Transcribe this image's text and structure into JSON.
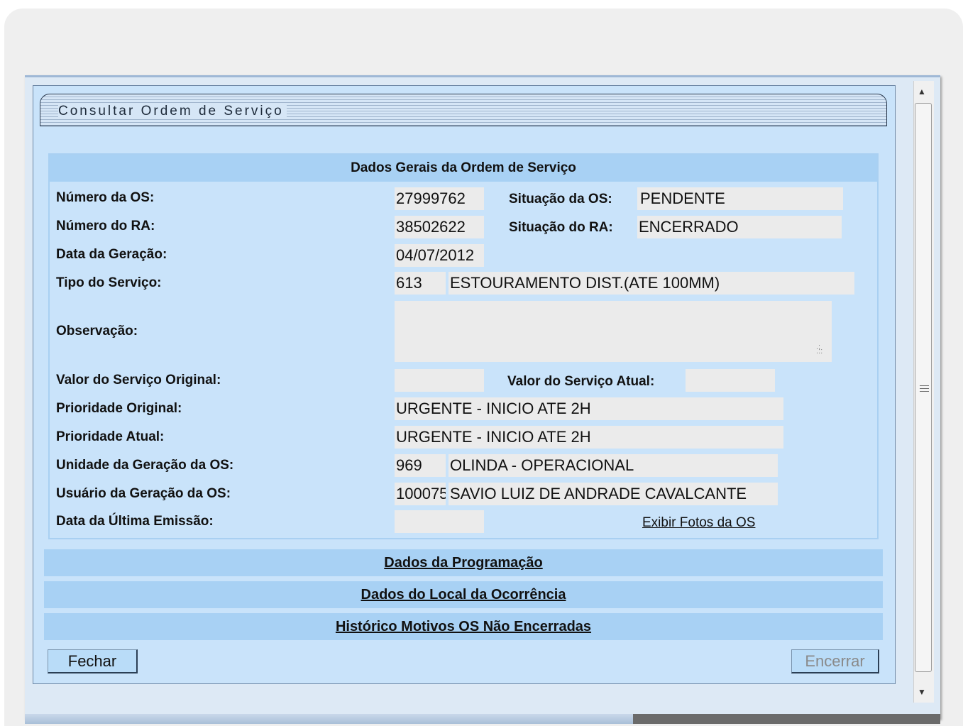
{
  "window": {
    "title": "Consultar Ordem de Serviço"
  },
  "section": {
    "header": "Dados Gerais da Ordem de Serviço",
    "labels": {
      "numero_os": "Número da OS:",
      "numero_ra": "Número do RA:",
      "data_geracao": "Data da Geração:",
      "tipo_servico": "Tipo do Serviço:",
      "observacao": "Observação:",
      "valor_original": "Valor do Serviço Original:",
      "prioridade_original": "Prioridade Original:",
      "prioridade_atual": "Prioridade Atual:",
      "unidade_geracao": "Unidade da Geração da OS:",
      "usuario_geracao": "Usuário da Geração da OS:",
      "data_ultima_emissao": "Data da Última Emissão:",
      "situacao_os": "Situação da OS:",
      "situacao_ra": "Situação do RA:",
      "valor_atual": "Valor do Serviço Atual:"
    },
    "values": {
      "numero_os": "27999762",
      "situacao_os": "PENDENTE",
      "numero_ra": "38502622",
      "situacao_ra": "ENCERRADO",
      "data_geracao": "04/07/2012",
      "tipo_servico_codigo": "613",
      "tipo_servico_descricao": "ESTOURAMENTO DIST.(ATE 100MM)",
      "observacao": "",
      "valor_original": "",
      "valor_atual": "",
      "prioridade_original": "URGENTE - INICIO ATE 2H",
      "prioridade_atual": "URGENTE - INICIO ATE 2H",
      "unidade_codigo": "969",
      "unidade_nome": "OLINDA - OPERACIONAL",
      "usuario_codigo": "100075",
      "usuario_nome": "SAVIO LUIZ DE ANDRADE CAVALCANTE",
      "data_ultima_emissao": ""
    },
    "link_fotos": "Exibir Fotos da OS"
  },
  "collapsibles": [
    "Dados da Programação",
    "Dados do Local da Ocorrência",
    "Histórico Motivos OS Não Encerradas"
  ],
  "buttons": {
    "fechar": "Fechar",
    "encerrar": "Encerrar"
  },
  "colors": {
    "panel_bg": "#c9e3fa",
    "header_bg": "#a8d1f4",
    "field_bg": "#ebebeb",
    "disabled_text": "#8a8a8a"
  }
}
